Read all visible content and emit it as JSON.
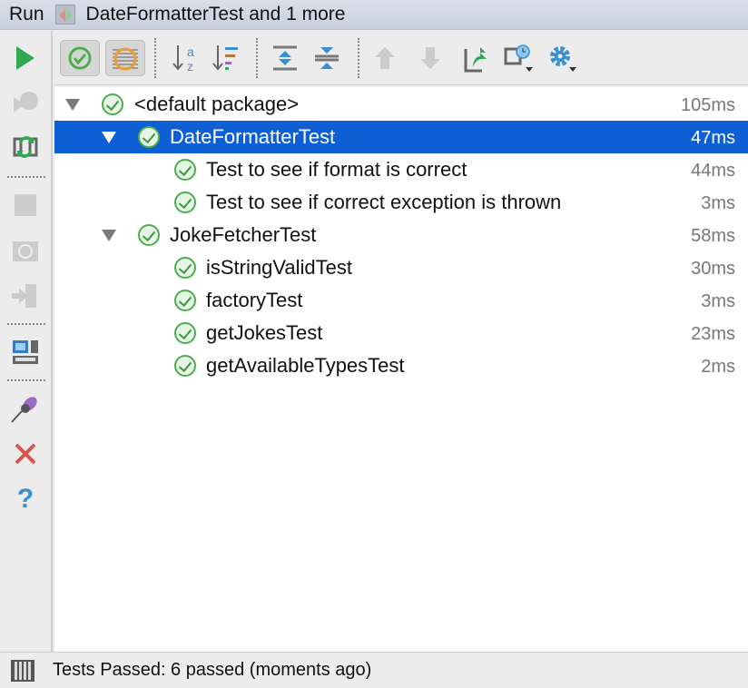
{
  "title": {
    "run_label": "Run",
    "tab_label": "DateFormatterTest and 1 more",
    "tab_icon": "run-config-icon"
  },
  "left_toolbar": [
    "rerun-icon",
    "rerun-failed-icon",
    "toggle-auto-test-icon",
    "stop-icon",
    "screenshot-icon",
    "export-icon",
    "layout-icon",
    "pin-icon",
    "close-icon",
    "help-icon"
  ],
  "top_toolbar": [
    "show-passed-icon",
    "show-ignored-icon",
    "sort-alphabetically-icon",
    "sort-by-duration-icon",
    "expand-all-icon",
    "collapse-all-icon",
    "previous-failed-icon",
    "next-failed-icon",
    "export-results-icon",
    "test-history-icon",
    "settings-icon"
  ],
  "tree": [
    {
      "label": "<default package>",
      "time": "105ms",
      "level": 0,
      "expanded": true,
      "selected": false
    },
    {
      "label": "DateFormatterTest",
      "time": "47ms",
      "level": 1,
      "expanded": true,
      "selected": true
    },
    {
      "label": "Test to see if format is correct",
      "time": "44ms",
      "level": 2
    },
    {
      "label": "Test to see if correct exception is thrown",
      "time": "3ms",
      "level": 2
    },
    {
      "label": "JokeFetcherTest",
      "time": "58ms",
      "level": 1,
      "expanded": true,
      "selected": false
    },
    {
      "label": "isStringValidTest",
      "time": "30ms",
      "level": 2
    },
    {
      "label": "factoryTest",
      "time": "3ms",
      "level": 2
    },
    {
      "label": "getJokesTest",
      "time": "23ms",
      "level": 2
    },
    {
      "label": "getAvailableTypesTest",
      "time": "2ms",
      "level": 2
    }
  ],
  "status": {
    "text": "Tests Passed: 6 passed (moments ago)"
  }
}
